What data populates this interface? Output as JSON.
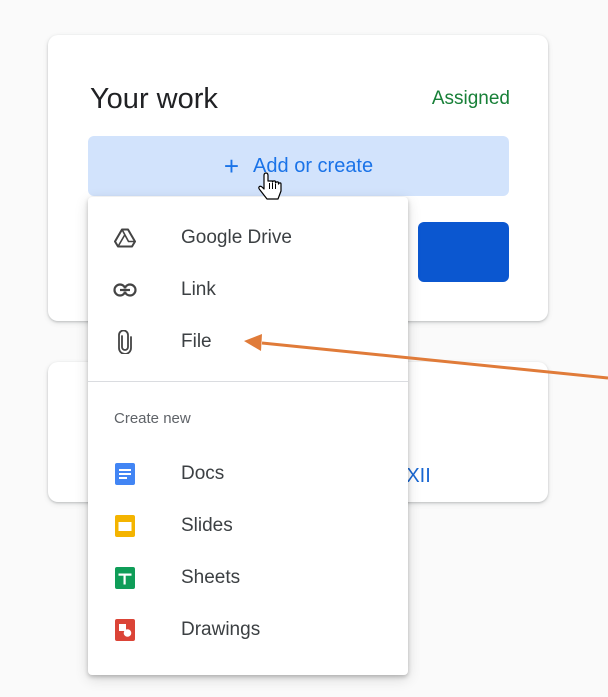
{
  "card": {
    "title": "Your work",
    "status": "Assigned",
    "add_label": "Add or create",
    "add_plus": "+"
  },
  "second_card": {
    "text": "td-XII"
  },
  "menu": {
    "attach_items": [
      {
        "label": "Google Drive",
        "icon": "google-drive-icon"
      },
      {
        "label": "Link",
        "icon": "link-icon"
      },
      {
        "label": "File",
        "icon": "paperclip-icon"
      }
    ],
    "create_section_label": "Create new",
    "create_items": [
      {
        "label": "Docs",
        "icon": "docs-icon",
        "color": "#4285f4"
      },
      {
        "label": "Slides",
        "icon": "slides-icon",
        "color": "#f4b400"
      },
      {
        "label": "Sheets",
        "icon": "sheets-icon",
        "color": "#0f9d58"
      },
      {
        "label": "Drawings",
        "icon": "drawings-icon",
        "color": "#db4437"
      }
    ]
  },
  "colors": {
    "accent": "#1a73e8",
    "status_green": "#188038",
    "annotation_arrow": "#e07b39"
  }
}
